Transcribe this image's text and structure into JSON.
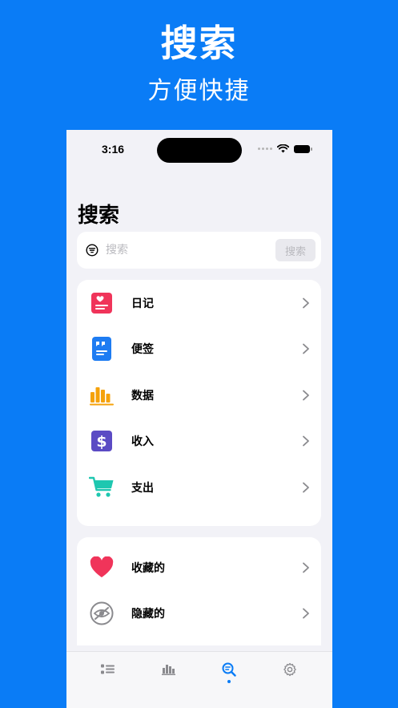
{
  "promo": {
    "title": "搜索",
    "subtitle": "方便快捷"
  },
  "status_bar": {
    "time": "3:16"
  },
  "page": {
    "title": "搜索"
  },
  "search": {
    "placeholder": "搜索",
    "button_label": "搜索"
  },
  "categories": [
    {
      "label": "日记",
      "icon": "diary-icon",
      "color": "#f0345a"
    },
    {
      "label": "便签",
      "icon": "note-icon",
      "color": "#1e7cf2"
    },
    {
      "label": "数据",
      "icon": "chart-icon",
      "color": "#f5a20a"
    },
    {
      "label": "收入",
      "icon": "dollar-icon",
      "color": "#5b4bc4"
    },
    {
      "label": "支出",
      "icon": "cart-icon",
      "color": "#1ec7b0"
    }
  ],
  "extras": [
    {
      "label": "收藏的",
      "icon": "heart-icon",
      "color": "#f0345a"
    },
    {
      "label": "隐藏的",
      "icon": "hidden-eye-icon",
      "color": "#8a8a8e"
    }
  ],
  "tab_bar": {
    "tabs": [
      "list-tab",
      "stats-tab",
      "search-tab",
      "settings-tab"
    ],
    "active": "search-tab",
    "active_color": "#0a7cf6",
    "inactive_color": "#8a8a8e"
  }
}
